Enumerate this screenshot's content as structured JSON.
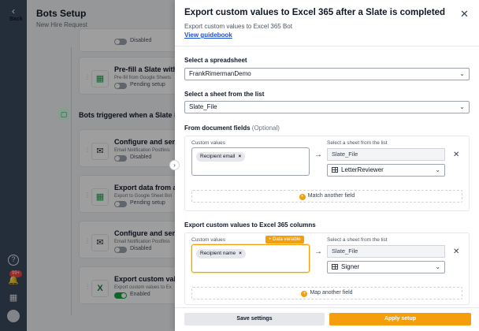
{
  "rail": {
    "back_label": "Back",
    "notif_badge": "99+"
  },
  "main": {
    "title": "Bots Setup",
    "subtitle": "New Hire Request",
    "cards": [
      {
        "title": "",
        "desc": "",
        "status": "Disabled",
        "enabled": false
      },
      {
        "title": "Pre-fill a Slate with d",
        "desc": "Pre-fill from Google Sheets",
        "status": "Pending setup",
        "enabled": false
      },
      {
        "title": "Configure and send",
        "desc": "Email Notification Postfinis",
        "status": "Disabled",
        "enabled": false
      },
      {
        "title": "Export data from a",
        "desc": "Export to Google Sheet Bot",
        "status": "Pending setup",
        "enabled": false
      },
      {
        "title": "Configure and send",
        "desc": "Email Notification Postfinis",
        "status": "Disabled",
        "enabled": false
      },
      {
        "title": "Export custom valu",
        "desc": "Export custom values to Ex",
        "status": "Enabled",
        "enabled": true
      }
    ],
    "section_title": "Bots triggered when a Slate is c"
  },
  "drawer": {
    "title": "Export custom values to Excel 365 after a Slate is completed",
    "subtitle": "Export custom values to Excel 365 Bot",
    "guide_link": "View guidebook",
    "spreadsheet_label": "Select a spreadsheet",
    "spreadsheet_value": "FrankRimermanDemo",
    "sheet_label": "Select a sheet from the list",
    "sheet_value": "Slate_File",
    "doc_fields_label": "From document fields",
    "doc_fields_optional": "(Optional)",
    "doc_mapping": {
      "custom_values_label": "Custom values",
      "tag": "Recipient email",
      "sheet_label": "Select a sheet from the list",
      "sheet_value": "Slate_File",
      "column_value": "LetterReviewer"
    },
    "match_another": "Match another field",
    "export_label": "Export custom values to Excel 365 columns",
    "export_mapping": {
      "custom_values_label": "Custom values",
      "data_variable": "+ Data variable",
      "tag": "Recipient name",
      "sheet_label": "Select a sheet from the list",
      "sheet_value": "Slate_File",
      "column_value": "Signer"
    },
    "map_another": "Map another field",
    "save_label": "Save settings",
    "apply_label": "Apply setup"
  }
}
